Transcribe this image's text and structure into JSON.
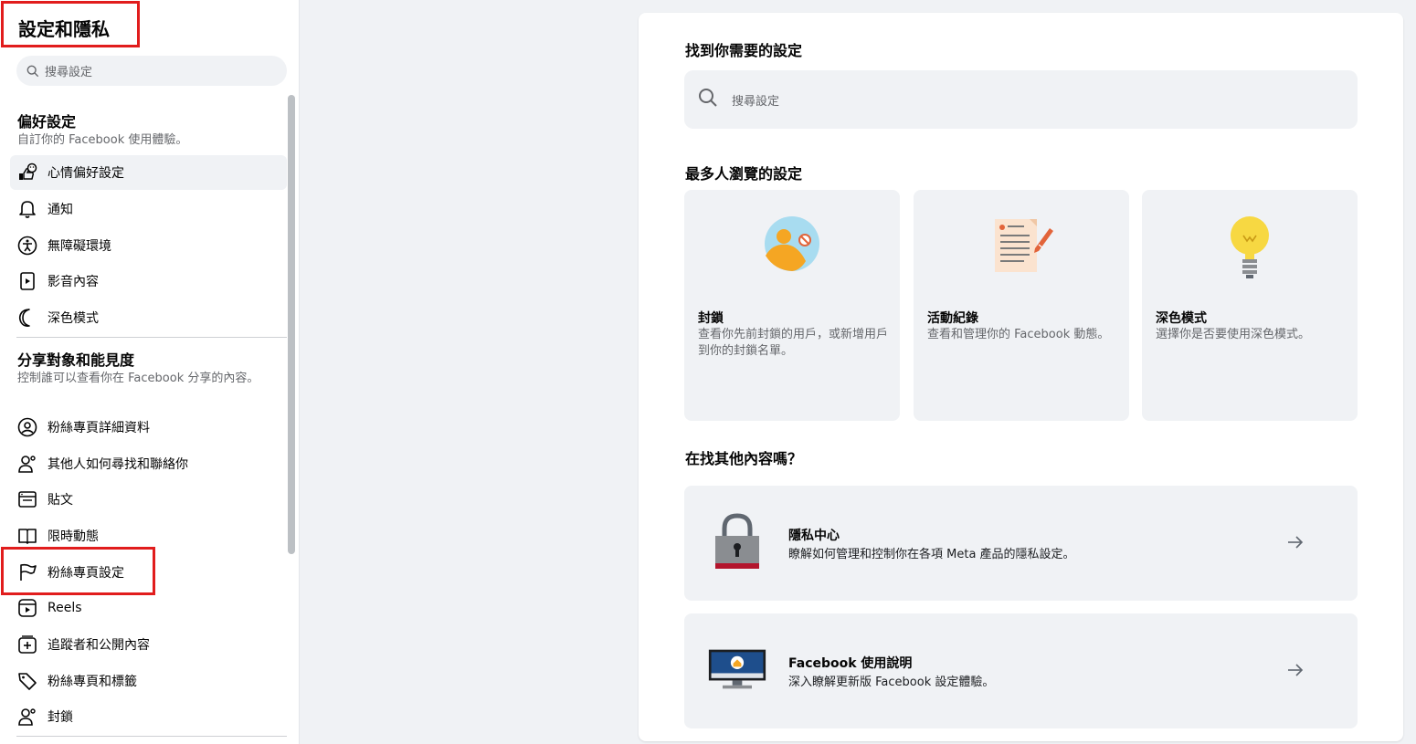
{
  "sidebar": {
    "title": "設定和隱私",
    "search_placeholder": "搜尋設定",
    "section1": {
      "heading": "偏好設定",
      "subtitle": "自訂你的 Facebook 使用體驗。",
      "items": [
        {
          "label": "心情偏好設定",
          "icon": "reactions-icon"
        },
        {
          "label": "通知",
          "icon": "bell-icon"
        },
        {
          "label": "無障礙環境",
          "icon": "accessibility-icon"
        },
        {
          "label": "影音內容",
          "icon": "media-icon"
        },
        {
          "label": "深色模式",
          "icon": "moon-icon"
        }
      ]
    },
    "section2": {
      "heading": "分享對象和能見度",
      "subtitle": "控制誰可以查看你在 Facebook 分享的內容。",
      "items": [
        {
          "label": "粉絲專頁詳細資料",
          "icon": "profile-icon"
        },
        {
          "label": "其他人如何尋找和聯絡你",
          "icon": "find-contact-icon"
        },
        {
          "label": "貼文",
          "icon": "posts-icon"
        },
        {
          "label": "限時動態",
          "icon": "stories-icon"
        },
        {
          "label": "粉絲專頁設定",
          "icon": "flag-icon"
        },
        {
          "label": "Reels",
          "icon": "reels-icon"
        },
        {
          "label": "追蹤者和公開內容",
          "icon": "followers-icon"
        },
        {
          "label": "粉絲專頁和標籤",
          "icon": "tag-icon"
        },
        {
          "label": "封鎖",
          "icon": "block-user-icon"
        }
      ]
    }
  },
  "main": {
    "find_heading": "找到你需要的設定",
    "search_placeholder": "搜尋設定",
    "popular_heading": "最多人瀏覽的設定",
    "cards": [
      {
        "title": "封鎖",
        "desc": "查看你先前封鎖的用戶，或新增用戶到你的封鎖名單。",
        "icon": "block-illustration"
      },
      {
        "title": "活動紀錄",
        "desc": "查看和管理你的 Facebook 動態。",
        "icon": "activity-log-illustration"
      },
      {
        "title": "深色模式",
        "desc": "選擇你是否要使用深色模式。",
        "icon": "lightbulb-illustration"
      }
    ],
    "more_heading": "在找其他內容嗎？",
    "rows": [
      {
        "title": "隱私中心",
        "desc": "瞭解如何管理和控制你在各項 Meta 產品的隱私設定。",
        "icon": "lock-illustration"
      },
      {
        "title": "Facebook 使用說明",
        "desc": "深入瞭解更新版 Facebook 設定體驗。",
        "icon": "monitor-illustration"
      }
    ]
  },
  "colors": {
    "highlight": "#e11d1d",
    "accent": "#f5a623",
    "bulb": "#f7d842"
  }
}
